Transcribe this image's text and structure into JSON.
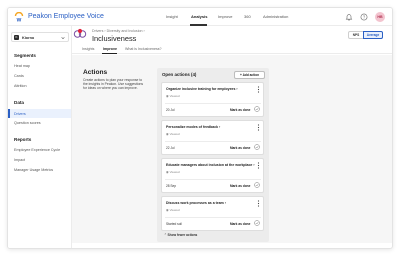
{
  "app": {
    "brand": "Peakon Employee Voice",
    "nav": [
      {
        "label": "Insight",
        "active": false
      },
      {
        "label": "Analysis",
        "active": true
      },
      {
        "label": "Improve",
        "active": false
      },
      {
        "label": "360",
        "active": false
      },
      {
        "label": "Administration",
        "active": false
      }
    ],
    "user_initials": "HB",
    "accent_color": "#2a5fc4"
  },
  "sidebar": {
    "team": {
      "badge": "K",
      "name": "Kiorno"
    },
    "sections": [
      {
        "heading": "Segments",
        "items": [
          "Heat map",
          "Cards",
          "Attrition"
        ]
      },
      {
        "heading": "Data",
        "items": [
          "Drivers",
          "Question scores"
        ],
        "active_item": "Drivers"
      },
      {
        "heading": "Reports",
        "items": [
          "Employee Experience Cycle",
          "Impact",
          "Manager Usage Metrics"
        ]
      }
    ]
  },
  "page": {
    "breadcrumb": "Drivers › Diversity and Inclusion ›",
    "title": "Inclusiveness",
    "toggle": {
      "left": "NPS",
      "right": "Average",
      "selected": "Average"
    },
    "tabs": [
      {
        "label": "Insights",
        "active": false
      },
      {
        "label": "Improve",
        "active": true
      },
      {
        "label": "What is Inclusiveness?",
        "active": false
      }
    ]
  },
  "actions": {
    "title": "Actions",
    "description": "Create actions to plan your response to the insights in Peakon. Use suggestions for ideas on where you can improve."
  },
  "open_actions": {
    "title": "Open actions (4)",
    "add_label": "+  Add action",
    "cards": [
      {
        "title": "Organize inclusive training for employees ›",
        "status": "Viewed",
        "date": "20 Jul",
        "done_label": "Mark as done"
      },
      {
        "title": "Personalize modes of feedback ›",
        "status": "Viewed",
        "date": "22 Jul",
        "done_label": "Mark as done"
      },
      {
        "title": "Educate managers about inclusion at the workplace ›",
        "status": "Viewed",
        "date": "28 Sep",
        "done_label": "Mark as done"
      },
      {
        "title": "Discuss work processes as a team ›",
        "status": "Viewed",
        "date": "Started soil",
        "done_label": "Mark as done"
      }
    ],
    "show_fewer_label": "⌃  Show fewer actions"
  }
}
